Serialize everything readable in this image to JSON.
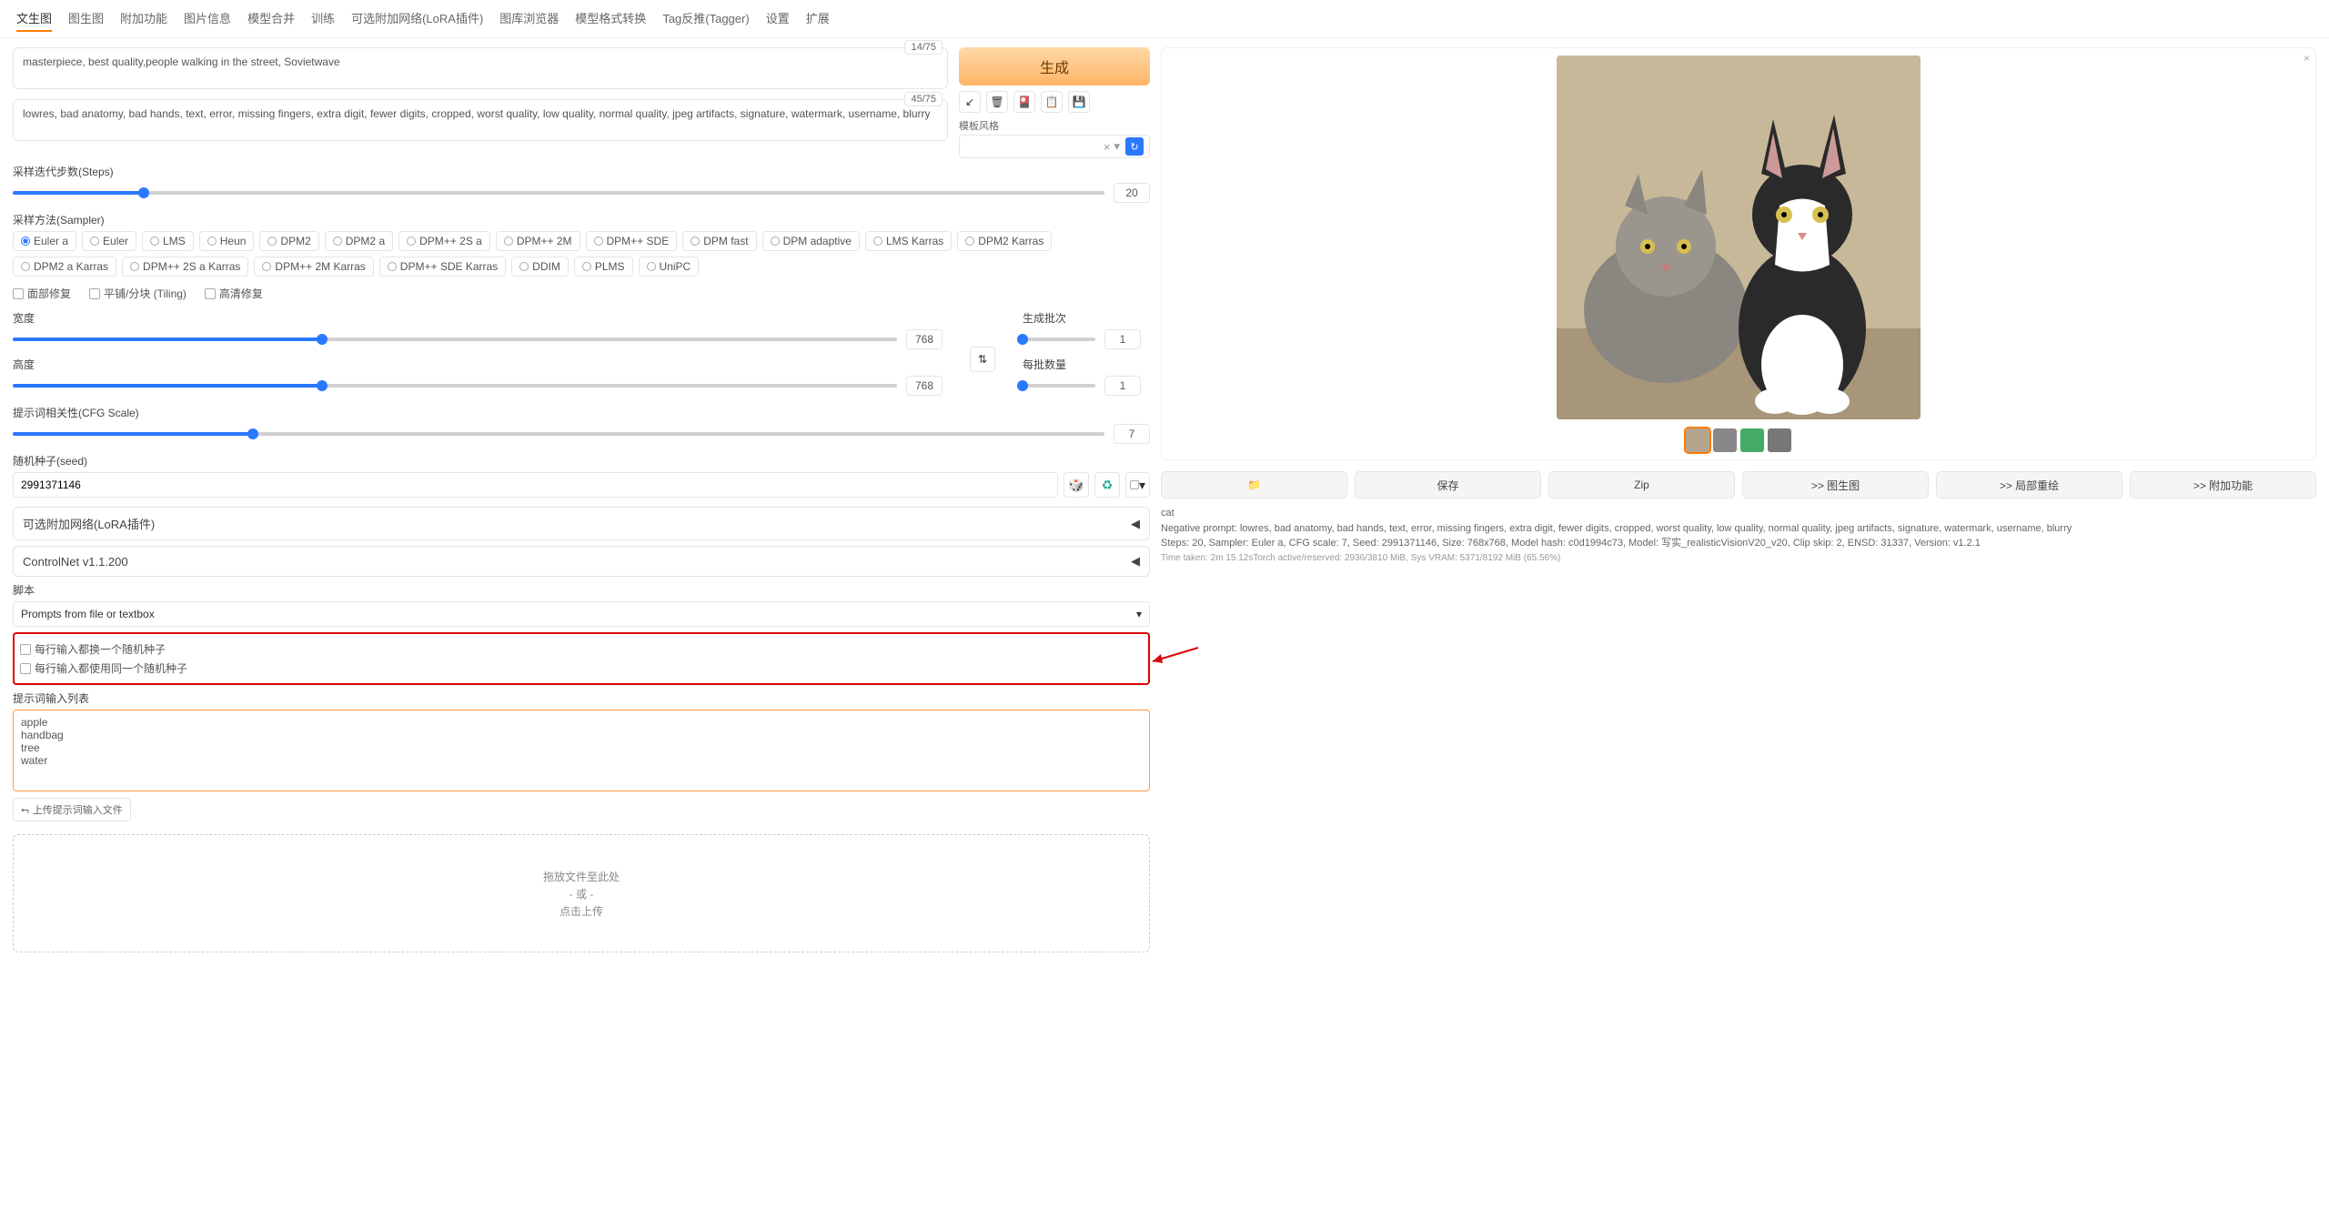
{
  "tabs": [
    "文生图",
    "图生图",
    "附加功能",
    "图片信息",
    "模型合并",
    "训练",
    "可选附加网络(LoRA插件)",
    "图库浏览器",
    "模型格式转换",
    "Tag反推(Tagger)",
    "设置",
    "扩展"
  ],
  "active_tab": 0,
  "prompt": {
    "value": "masterpiece, best quality,people walking in the street, Sovietwave",
    "counter": "14/75"
  },
  "neg_prompt": {
    "value": "lowres, bad anatomy, bad hands, text, error, missing fingers, extra digit, fewer digits, cropped, worst quality, low quality, normal quality, jpeg artifacts, signature, watermark, username, blurry",
    "counter": "45/75"
  },
  "generate_label": "生成",
  "style_label": "模板风格",
  "steps": {
    "label": "采样迭代步数(Steps)",
    "value": "20",
    "pct": 12
  },
  "sampler": {
    "label": "采样方法(Sampler)",
    "selected": "Euler a",
    "options": [
      "Euler a",
      "Euler",
      "LMS",
      "Heun",
      "DPM2",
      "DPM2 a",
      "DPM++ 2S a",
      "DPM++ 2M",
      "DPM++ SDE",
      "DPM fast",
      "DPM adaptive",
      "LMS Karras",
      "DPM2 Karras",
      "DPM2 a Karras",
      "DPM++ 2S a Karras",
      "DPM++ 2M Karras",
      "DPM++ SDE Karras",
      "DDIM",
      "PLMS",
      "UniPC"
    ]
  },
  "checks": {
    "face": "面部修复",
    "tiling": "平铺/分块 (Tiling)",
    "hires": "高清修复"
  },
  "width": {
    "label": "宽度",
    "value": "768",
    "pct": 35
  },
  "height": {
    "label": "高度",
    "value": "768",
    "pct": 35
  },
  "batch_count": {
    "label": "生成批次",
    "value": "1",
    "pct": 0
  },
  "batch_size": {
    "label": "每批数量",
    "value": "1",
    "pct": 0
  },
  "cfg": {
    "label": "提示词相关性(CFG Scale)",
    "value": "7",
    "pct": 22
  },
  "seed": {
    "label": "随机种子(seed)",
    "value": "2991371146"
  },
  "accordion1": "可选附加网络(LoRA插件)",
  "accordion2": "ControlNet v1.1.200",
  "script": {
    "label": "脚本",
    "selected": "Prompts from file or textbox"
  },
  "script_checks": {
    "a": "每行输入都换一个随机种子",
    "b": "每行输入都使用同一个随机种子"
  },
  "prompt_list": {
    "label": "提示词输入列表",
    "value": "apple\nhandbag\ntree\nwater"
  },
  "upload_label": "上传提示词输入文件",
  "drop": {
    "line1": "拖放文件至此处",
    "line2": "- 或 -",
    "line3": "点击上传"
  },
  "actions": {
    "folder": "📁",
    "save": "保存",
    "zip": "Zip",
    "img2img": ">> 图生图",
    "inpaint": ">> 局部重绘",
    "extras": ">> 附加功能"
  },
  "info": {
    "prompt_line": "cat",
    "neg_line": "Negative prompt: lowres, bad anatomy, bad hands, text, error, missing fingers, extra digit, fewer digits, cropped, worst quality, low quality, normal quality, jpeg artifacts, signature, watermark, username, blurry",
    "params": "Steps: 20, Sampler: Euler a, CFG scale: 7, Seed: 2991371146, Size: 768x768, Model hash: c0d1994c73, Model: 写实_realisticVisionV20_v20, Clip skip: 2, ENSD: 31337, Version: v1.2.1",
    "time": "Time taken: 2m 15.12sTorch active/reserved: 2936/3810 MiB, Sys VRAM: 5371/8192 MiB (65.56%)"
  }
}
